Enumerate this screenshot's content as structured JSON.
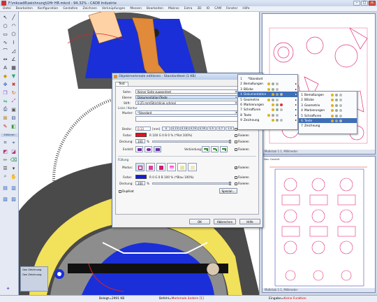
{
  "window": {
    "title": "F:\\mkcad8\\zeichnung\\UHr H8.mkcd - 94,32% - CAD8 Industrie"
  },
  "menu": [
    "Datei",
    "Bearbeiten",
    "Konfiguration",
    "Gestalten",
    "Zeichnen",
    "Verknüpfungen",
    "Messen",
    "Bearbeiten",
    "Makros",
    "Extra",
    "3D",
    "IO",
    "CAM",
    "Fenster",
    "Hilfe"
  ],
  "left_toolbar": {
    "section_label": "Editieren"
  },
  "status": {
    "belegt": "Belegt=",
    "belegt_val": "2991 KB",
    "befehl": "Befehl=",
    "befehl_val": "Merkmale ändern [1]",
    "eingabe": "Eingabe=",
    "eingabe_val": "Keine Funktion"
  },
  "subwin_top": {
    "title": "Maßstab 1:1, Millimeter"
  },
  "subwin_bottom": {
    "tab": "Neu Gestalt",
    "title": "Maßstab 1:1, Millimeter"
  },
  "layer_panel": {
    "row1": "Gen Zeichnung",
    "row2": "Gen Zeichnung"
  },
  "dialog": {
    "title": "Objektmerkmale editieren - Standardtext (1 KB)",
    "tab": "Text",
    "seite_label": "Seite:",
    "seite_val": "Keiner Seite zugeordnet",
    "ebene_label": "Ebene:",
    "ebene_val": "Dokumentation\\Texte",
    "stift_label": "Stift:",
    "stift_val": "0,25 mm\\Strichlinie schmal",
    "linie_section": "Linie / Kontur",
    "muster_label": "Muster:",
    "muster_val": "*Standard",
    "breite_label": "Breite:",
    "breite_val": "0,13",
    "breite_unit": "[mm]",
    "widths": [
      "0",
      "0,13",
      "0,18",
      "0,25",
      "0,35",
      "0,5",
      "0,7",
      "1,0"
    ],
    "farbe_label": "Farbe:",
    "farbe_val": "R 100 G 0 B 0 %  (*Rot 100%)",
    "deckung_label": "Deckung:",
    "deckung_val": "100",
    "pct": "%",
    "endstil_label": "Endstil:",
    "verbindung_label": "Verbindung:",
    "fuellung_section": "Füllung",
    "modus_label": "Modus:",
    "farbe2_label": "Farbe:",
    "farbe2_val": "R 0 G 0 B 100 %  (*Blau 100%)",
    "deckung2_label": "Deckung:",
    "deckung2_val": "100",
    "fixieren": "Fixieren",
    "duplikat": "Duplikat",
    "spezial": "Spezial...",
    "ok": "OK",
    "abbrechen": "Abbrechen",
    "hilfe": "Hilfe",
    "colors": {
      "line": "#e8101a",
      "fill": "#1020d8"
    }
  },
  "popup1": {
    "items": [
      {
        "num": "1",
        "label": "*Standard"
      },
      {
        "num": "2",
        "label": "Bemaßungen"
      },
      {
        "num": "3",
        "label": "Blöcke"
      },
      {
        "num": "4",
        "label": "Dokumentation"
      },
      {
        "num": "5",
        "label": "Geometrie"
      },
      {
        "num": "6",
        "label": "Markierungen"
      },
      {
        "num": "7",
        "label": "Schraffuren"
      },
      {
        "num": "8",
        "label": "Texte"
      },
      {
        "num": "9",
        "label": "Zeichnung"
      }
    ]
  },
  "popup2": {
    "items": [
      {
        "num": "1",
        "label": "Bemaßungen"
      },
      {
        "num": "2",
        "label": "Blöcke"
      },
      {
        "num": "3",
        "label": "Geometrie"
      },
      {
        "num": "4",
        "label": "Markierungen"
      },
      {
        "num": "5",
        "label": "Schraffuren"
      },
      {
        "num": "6",
        "label": "Texte"
      },
      {
        "num": "7",
        "label": "Zeichnung"
      }
    ]
  }
}
